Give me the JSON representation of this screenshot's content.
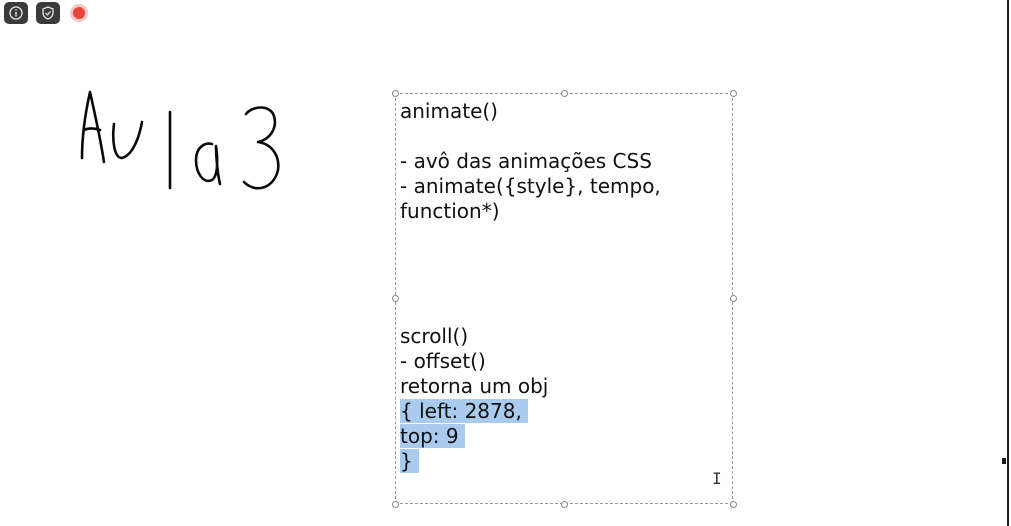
{
  "toolbar": {
    "icons": [
      "info-icon",
      "shield-icon",
      "record-icon"
    ]
  },
  "canvas": {
    "handwriting": "Aula 3"
  },
  "textbox": {
    "lines": [
      "animate()",
      "",
      "- avô das animações CSS",
      "- animate({style}, tempo,",
      "function*)",
      "scroll()",
      "- offset()",
      "retorna um obj",
      "{ left: 2878,",
      "top: 9",
      "}"
    ],
    "selected_lines": [
      "{ left: 2878,",
      "top: 9",
      "}"
    ],
    "selection_color": "#a9cbee"
  }
}
